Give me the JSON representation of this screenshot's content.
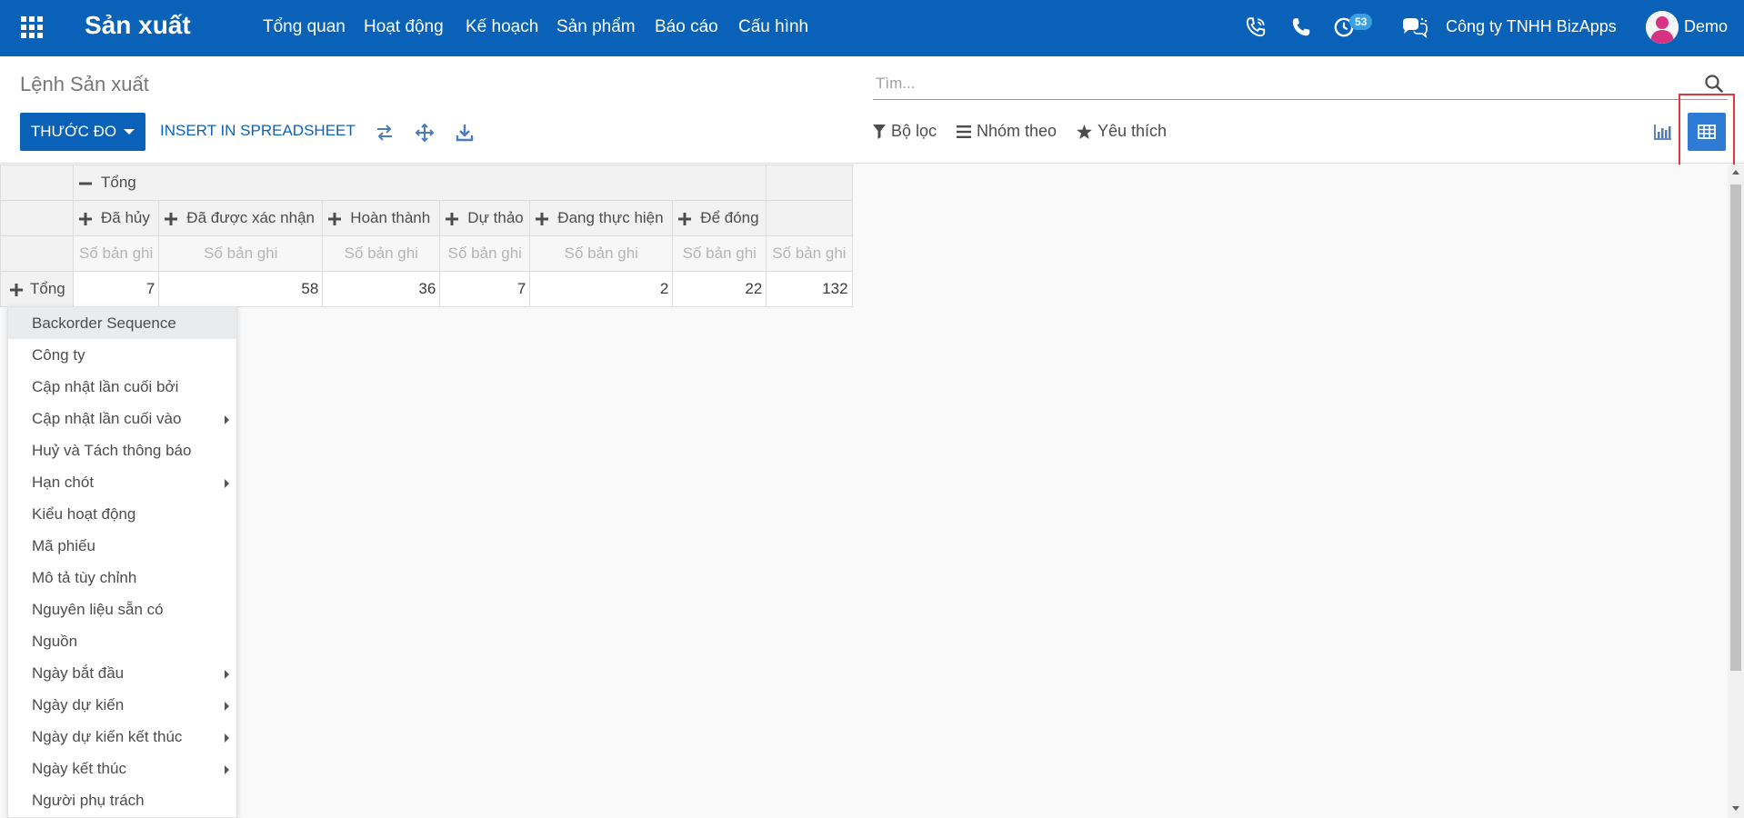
{
  "navbar": {
    "app_name": "Sản xuất",
    "menu": [
      "Tổng quan",
      "Hoạt động",
      "Kế hoạch",
      "Sản phẩm",
      "Báo cáo",
      "Cấu hình"
    ],
    "activity_count": "53",
    "company": "Công ty TNHH BizApps",
    "user": "Demo",
    "icons": [
      "apps-grid-icon",
      "voip-phone-icon",
      "phone-icon",
      "activity-clock-icon",
      "chat-icon",
      "avatar"
    ]
  },
  "control_panel": {
    "title": "Lệnh Sản xuất",
    "search_placeholder": "Tìm...",
    "measures_label": "THƯỚC ĐO",
    "insert_label": "INSERT IN SPREADSHEET",
    "filter_label": "Bộ lọc",
    "group_by_label": "Nhóm theo",
    "favorites_label": "Yêu thích"
  },
  "pivot": {
    "column_header_total": "Tổng",
    "columns": [
      "Đã hủy",
      "Đã được xác nhận",
      "Hoàn thành",
      "Dự thảo",
      "Đang thực hiện",
      "Để đóng"
    ],
    "measure_label": "Số bản ghi",
    "row_header": "Tổng",
    "values": [
      "7",
      "58",
      "36",
      "7",
      "2",
      "22"
    ],
    "total": "132"
  },
  "dropdown": {
    "items": [
      {
        "label": "Backorder Sequence",
        "submenu": false
      },
      {
        "label": "Công ty",
        "submenu": false
      },
      {
        "label": "Cập nhật lần cuối bởi",
        "submenu": false
      },
      {
        "label": "Cập nhật lần cuối vào",
        "submenu": true
      },
      {
        "label": "Huỷ và Tách thông báo",
        "submenu": false
      },
      {
        "label": "Hạn chót",
        "submenu": true
      },
      {
        "label": "Kiểu hoạt động",
        "submenu": false
      },
      {
        "label": "Mã phiếu",
        "submenu": false
      },
      {
        "label": "Mô tả tùy chỉnh",
        "submenu": false
      },
      {
        "label": "Nguyên liệu sẵn có",
        "submenu": false
      },
      {
        "label": "Nguồn",
        "submenu": false
      },
      {
        "label": "Ngày bắt đầu",
        "submenu": true
      },
      {
        "label": "Ngày dự kiến",
        "submenu": true
      },
      {
        "label": "Ngày dự kiến kết thúc",
        "submenu": true
      },
      {
        "label": "Ngày kết thúc",
        "submenu": true
      },
      {
        "label": "Người phụ trách",
        "submenu": false
      }
    ]
  },
  "colors": {
    "navbar": "#0a62b8",
    "primary_button": "#0a62b8",
    "active_view": "#2e7bd6",
    "highlight_box": "#e0363c"
  }
}
